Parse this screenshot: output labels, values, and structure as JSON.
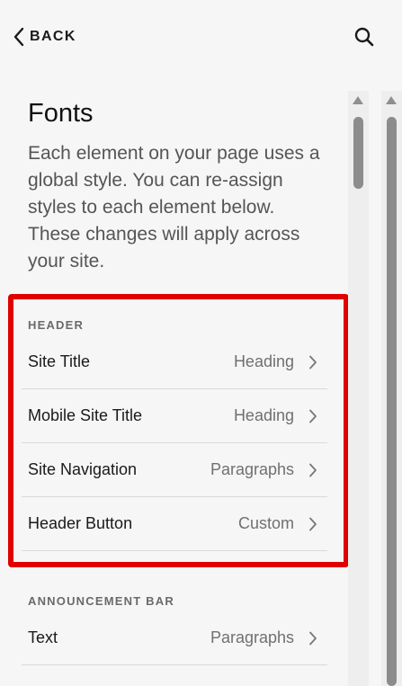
{
  "header": {
    "back_label": "BACK",
    "back_icon": "chevron-left-icon",
    "search_icon": "search-icon"
  },
  "main": {
    "title": "Fonts",
    "description": "Each element on your page uses a global style. You can re-assign styles to each element below. These changes will apply across your site."
  },
  "sections": {
    "header": {
      "label": "HEADER",
      "items": [
        {
          "label": "Site Title",
          "value": "Heading"
        },
        {
          "label": "Mobile Site Title",
          "value": "Heading"
        },
        {
          "label": "Site Navigation",
          "value": "Paragraphs"
        },
        {
          "label": "Header Button",
          "value": "Custom"
        }
      ]
    },
    "announcement_bar": {
      "label": "ANNOUNCEMENT BAR",
      "items": [
        {
          "label": "Text",
          "value": "Paragraphs"
        }
      ]
    }
  },
  "colors": {
    "highlight_border": "#e00000",
    "text_primary": "#1a1a1a",
    "text_secondary": "#707070"
  }
}
